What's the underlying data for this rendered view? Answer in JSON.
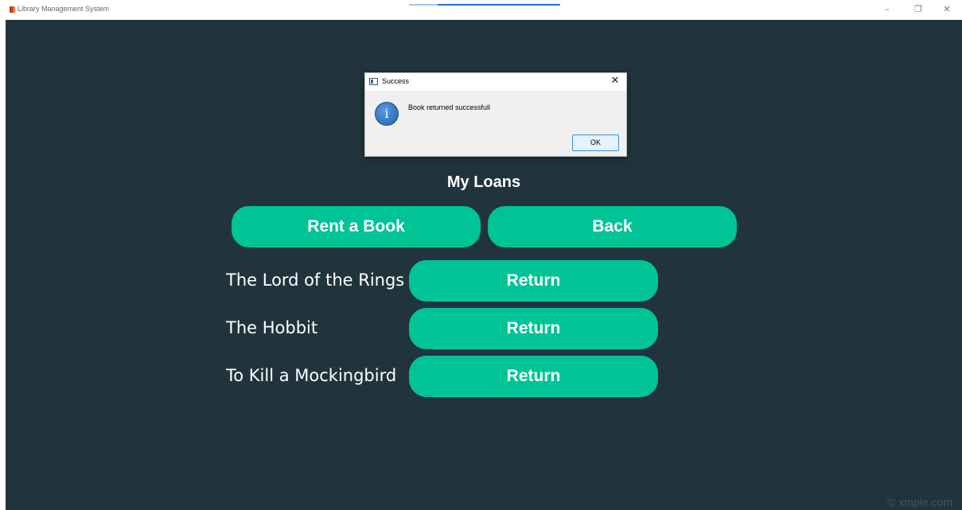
{
  "window": {
    "title": "Library Management System",
    "controls": {
      "minimize": "–",
      "maximize": "❐",
      "close": "✕"
    }
  },
  "page": {
    "heading": "My Loans",
    "rent_button": "Rent a Book",
    "back_button": "Back",
    "loans": [
      {
        "title": "The Lord of the Rings",
        "action": "Return"
      },
      {
        "title": "The Hobbit",
        "action": "Return"
      },
      {
        "title": "To Kill a Mockingbird",
        "action": "Return"
      }
    ],
    "watermark": "© xmple.com"
  },
  "dialog": {
    "title": "Success",
    "close_glyph": "✕",
    "icon": "info-icon",
    "icon_glyph": "i",
    "message": "Book returned successfull",
    "ok_label": "OK"
  },
  "colors": {
    "background": "#21343e",
    "accent": "#00c496",
    "text": "#ffffff",
    "dialog_bg": "#f0f0f0",
    "ok_border": "#3c8fcf"
  }
}
